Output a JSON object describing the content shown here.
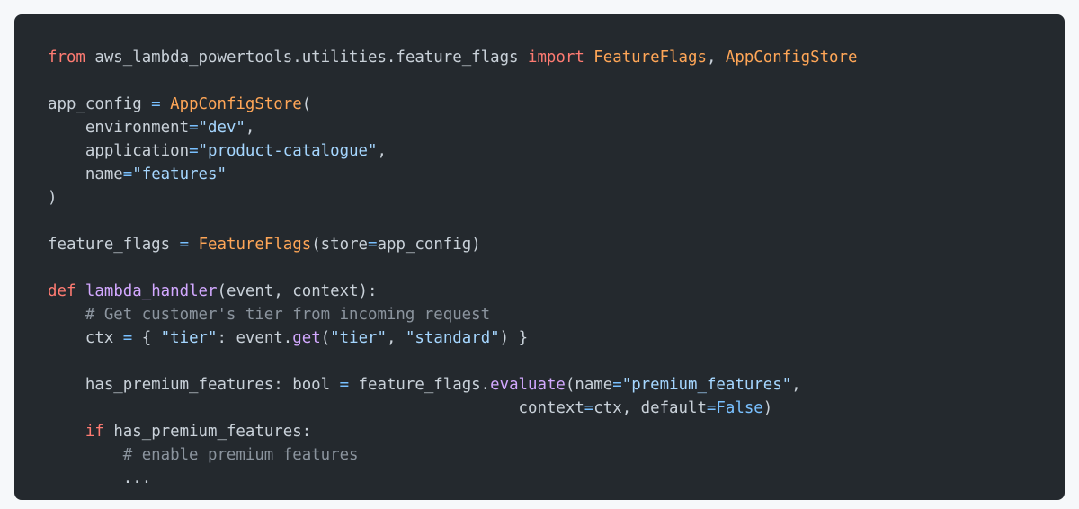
{
  "theme": {
    "background": "#24292e",
    "text": "#c9d1d9",
    "keyword": "#ff7b72",
    "class": "#ffa657",
    "function": "#d2a8ff",
    "string": "#a5d6ff",
    "operator": "#79c0ff",
    "comment": "#8b949e"
  },
  "lines": [
    [
      [
        "kw",
        "from"
      ],
      [
        "txt",
        " aws_lambda_powertools.utilities.feature_flags "
      ],
      [
        "kw",
        "import"
      ],
      [
        "txt",
        " "
      ],
      [
        "cls",
        "FeatureFlags"
      ],
      [
        "txt",
        ", "
      ],
      [
        "cls",
        "AppConfigStore"
      ]
    ],
    [],
    [
      [
        "txt",
        "app_config "
      ],
      [
        "op",
        "="
      ],
      [
        "txt",
        " "
      ],
      [
        "cls",
        "AppConfigStore"
      ],
      [
        "txt",
        "("
      ]
    ],
    [
      [
        "txt",
        "    environment"
      ],
      [
        "op",
        "="
      ],
      [
        "str",
        "\"dev\""
      ],
      [
        "txt",
        ","
      ]
    ],
    [
      [
        "txt",
        "    application"
      ],
      [
        "op",
        "="
      ],
      [
        "str",
        "\"product-catalogue\""
      ],
      [
        "txt",
        ","
      ]
    ],
    [
      [
        "txt",
        "    name"
      ],
      [
        "op",
        "="
      ],
      [
        "str",
        "\"features\""
      ]
    ],
    [
      [
        "txt",
        ")"
      ]
    ],
    [],
    [
      [
        "txt",
        "feature_flags "
      ],
      [
        "op",
        "="
      ],
      [
        "txt",
        " "
      ],
      [
        "cls",
        "FeatureFlags"
      ],
      [
        "txt",
        "(store"
      ],
      [
        "op",
        "="
      ],
      [
        "txt",
        "app_config)"
      ]
    ],
    [],
    [
      [
        "kw",
        "def"
      ],
      [
        "txt",
        " "
      ],
      [
        "fn",
        "lambda_handler"
      ],
      [
        "txt",
        "(event, context):"
      ]
    ],
    [
      [
        "cmt",
        "    # Get customer's tier from incoming request"
      ]
    ],
    [
      [
        "txt",
        "    ctx "
      ],
      [
        "op",
        "="
      ],
      [
        "txt",
        " { "
      ],
      [
        "str",
        "\"tier\""
      ],
      [
        "txt",
        ": event."
      ],
      [
        "fn",
        "get"
      ],
      [
        "txt",
        "("
      ],
      [
        "str",
        "\"tier\""
      ],
      [
        "txt",
        ", "
      ],
      [
        "str",
        "\"standard\""
      ],
      [
        "txt",
        ") }"
      ]
    ],
    [],
    [
      [
        "txt",
        "    has_premium_features: bool "
      ],
      [
        "op",
        "="
      ],
      [
        "txt",
        " feature_flags."
      ],
      [
        "fn",
        "evaluate"
      ],
      [
        "txt",
        "(name"
      ],
      [
        "op",
        "="
      ],
      [
        "str",
        "\"premium_features\""
      ],
      [
        "txt",
        ","
      ]
    ],
    [
      [
        "txt",
        "                                                  context"
      ],
      [
        "op",
        "="
      ],
      [
        "txt",
        "ctx, default"
      ],
      [
        "op",
        "="
      ],
      [
        "op",
        "False"
      ],
      [
        "txt",
        ")"
      ]
    ],
    [
      [
        "txt",
        "    "
      ],
      [
        "kw",
        "if"
      ],
      [
        "txt",
        " has_premium_features:"
      ]
    ],
    [
      [
        "cmt",
        "        # enable premium features"
      ]
    ],
    [
      [
        "txt",
        "        ..."
      ]
    ]
  ]
}
